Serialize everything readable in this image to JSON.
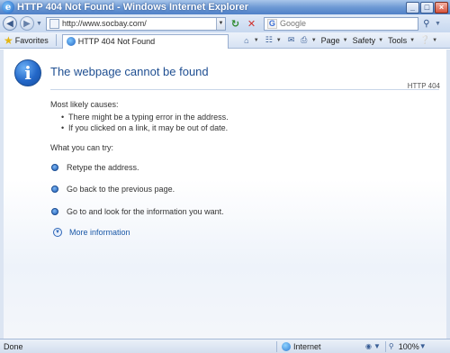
{
  "window": {
    "title": "HTTP 404 Not Found - Windows Internet Explorer",
    "buttons": {
      "minimize": "_",
      "maximize": "□",
      "close": "×"
    }
  },
  "address_bar": {
    "url": "http://www.socbay.com/",
    "search_placeholder": "Google"
  },
  "favorites_bar": {
    "favorites_label": "Favorites",
    "tab_title": "HTTP 404 Not Found",
    "commands": {
      "page": "Page",
      "safety": "Safety",
      "tools": "Tools"
    }
  },
  "error_page": {
    "heading": "The webpage cannot be found",
    "code": "HTTP 404",
    "causes_title": "Most likely causes:",
    "causes": [
      "There might be a typing error in the address.",
      "If you clicked on a link, it may be out of date."
    ],
    "try_title": "What you can try:",
    "try_items": [
      "Retype the address.",
      "Go back to the previous page.",
      "Go to  and look for the information you want."
    ],
    "more_info": "More information"
  },
  "status_bar": {
    "status": "Done",
    "zone": "Internet",
    "zoom": "100%"
  },
  "colors": {
    "heading": "#1f4f92",
    "titlebar": "#4f80c8",
    "link": "#1a58a7"
  }
}
